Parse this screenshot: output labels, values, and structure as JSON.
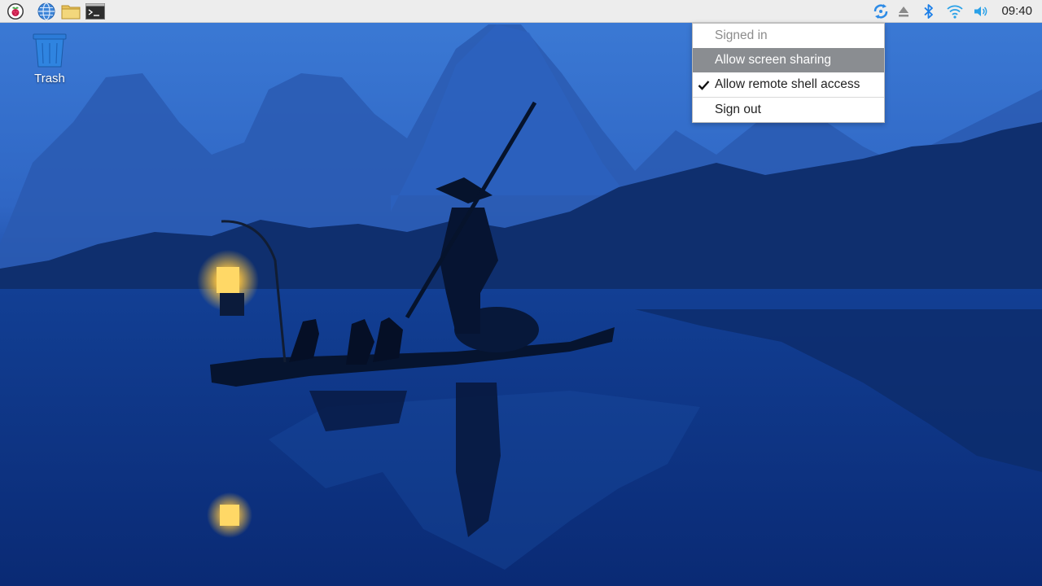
{
  "taskbar": {
    "launchers": [
      {
        "name": "raspberry-menu-icon"
      },
      {
        "name": "web-browser-icon"
      },
      {
        "name": "file-manager-icon"
      },
      {
        "name": "terminal-icon"
      }
    ],
    "tray": [
      {
        "name": "vnc-icon"
      },
      {
        "name": "eject-icon"
      },
      {
        "name": "bluetooth-icon"
      },
      {
        "name": "wifi-icon"
      },
      {
        "name": "volume-icon"
      }
    ],
    "clock": "09:40"
  },
  "desktop": {
    "trash_label": "Trash"
  },
  "menu": {
    "items": [
      {
        "label": "Signed in",
        "state": "disabled"
      },
      {
        "label": "Allow screen sharing",
        "state": "highlighted"
      },
      {
        "label": "Allow remote shell access",
        "state": "checked"
      },
      {
        "label": "Sign out",
        "state": "normal"
      }
    ]
  },
  "colors": {
    "accent": "#1a7ee8",
    "menu_highlight": "#8a8d91",
    "taskbar": "#ededed"
  }
}
